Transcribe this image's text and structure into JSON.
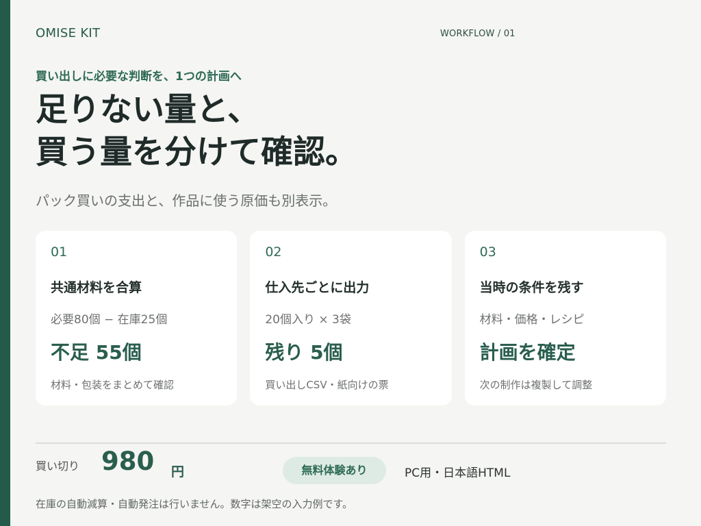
{
  "brand": "OMISE KIT",
  "workflow": "WORKFLOW / 01",
  "kicker": "買い出しに必要な判断を、1つの計画へ",
  "headline": {
    "line1": "足りない量と、",
    "line2": "買う量を分けて確認。"
  },
  "lead": "パック買いの支出と、作品に使う原価も別表示。",
  "cards": [
    {
      "num": "01",
      "title": "共通材料を合算",
      "detail": "必要80個 − 在庫25個",
      "result": "不足 55個",
      "note": "材料・包装をまとめて確認"
    },
    {
      "num": "02",
      "title": "仕入先ごとに出力",
      "detail": "20個入り × 3袋",
      "result": "残り 5個",
      "note": "買い出しCSV・紙向けの票"
    },
    {
      "num": "03",
      "title": "当時の条件を残す",
      "detail": "材料・価格・レシピ",
      "result": "計画を確定",
      "note": "次の制作は複製して調整"
    }
  ],
  "footer": {
    "price_label": "買い切り",
    "price_value": "980",
    "price_unit": "円",
    "trial_badge": "無料体験あり",
    "platform": "PC用・日本語HTML",
    "disclaimer": "在庫の自動減算・自動発注は行いません。数字は架空の入力例です。"
  },
  "colors": {
    "accent": "#245a4a",
    "background": "#f5f5f3",
    "card": "#ffffff",
    "badge_bg": "#deebe4"
  }
}
